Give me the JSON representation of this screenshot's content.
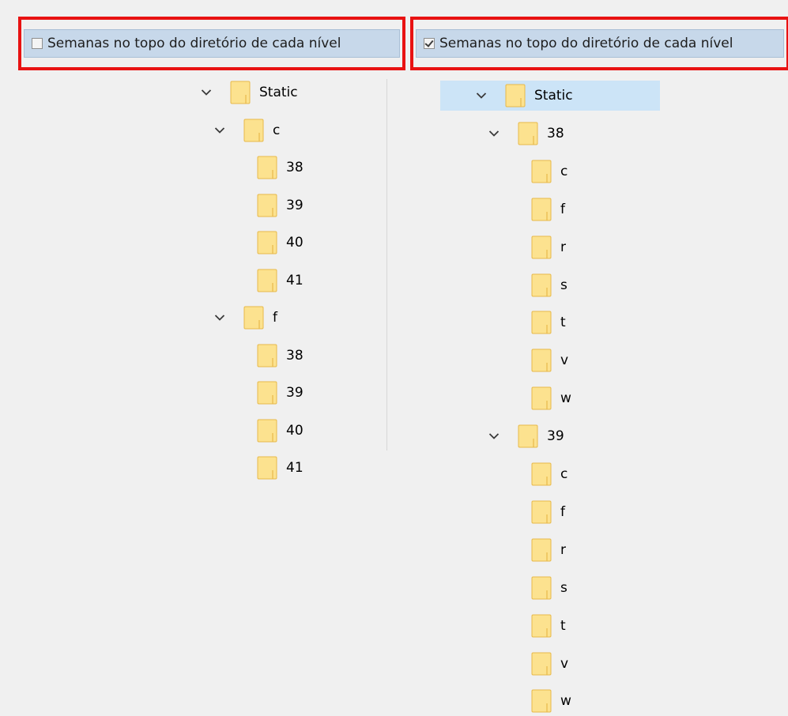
{
  "left_panel": {
    "option": {
      "label": "Semanas no topo do diretório de cada nível",
      "checked": false
    },
    "tree": {
      "root": "Static",
      "groups": [
        {
          "label": "c",
          "children": [
            "38",
            "39",
            "40",
            "41"
          ]
        },
        {
          "label": "f",
          "children": [
            "38",
            "39",
            "40",
            "41"
          ]
        }
      ]
    }
  },
  "right_panel": {
    "option": {
      "label": "Semanas no topo do diretório de cada nível",
      "checked": true
    },
    "tree": {
      "root": "Static",
      "root_selected": true,
      "groups": [
        {
          "label": "38",
          "children": [
            "c",
            "f",
            "r",
            "s",
            "t",
            "v",
            "w"
          ]
        },
        {
          "label": "39",
          "children": [
            "c",
            "f",
            "r",
            "s",
            "t",
            "v",
            "w"
          ]
        }
      ]
    }
  },
  "icons": {
    "expanded": "chevron-down-icon",
    "folder": "folder-icon"
  },
  "colors": {
    "highlight_border": "#e81212",
    "option_bar": "#c7d8ea",
    "selection": "#cce4f7",
    "folder_body": "#fce28f",
    "folder_edge": "#e7b94a"
  }
}
